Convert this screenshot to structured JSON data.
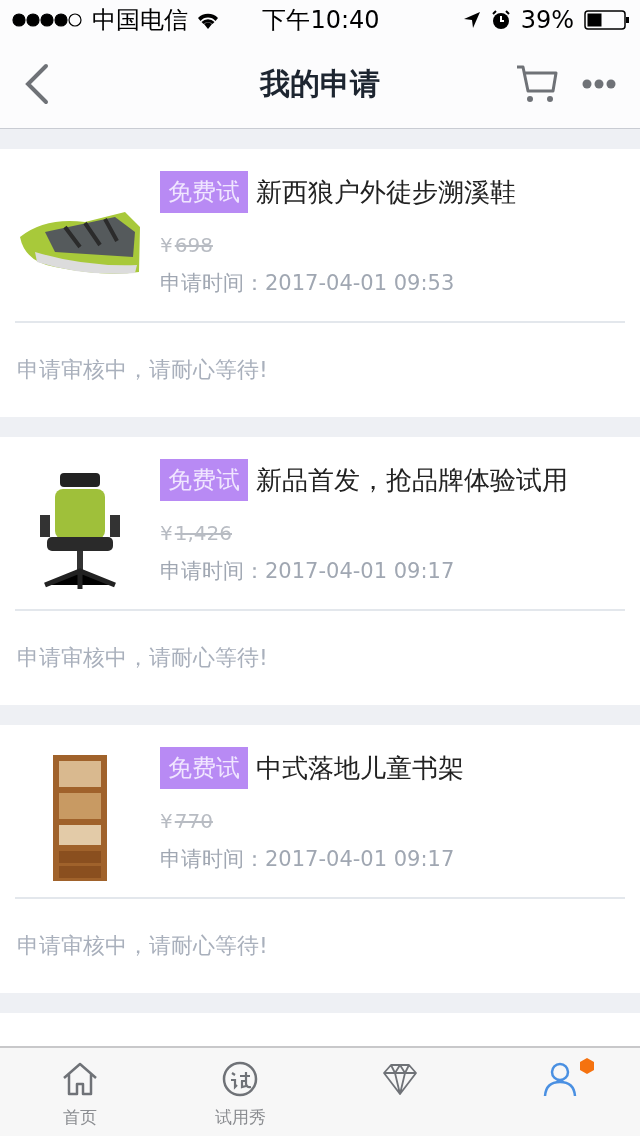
{
  "status_bar": {
    "carrier": "中国电信",
    "time": "下午10:40",
    "battery_text": "39%"
  },
  "nav": {
    "title": "我的申请"
  },
  "applications": [
    {
      "badge": "免费试",
      "title": "新西狼户外徒步溯溪鞋",
      "currency": "¥",
      "price": "698",
      "time": "申请时间：2017-04-01 09:53",
      "status": "申请审核中，请耐心等待!",
      "kind": "shoe"
    },
    {
      "badge": "免费试",
      "title": "新品首发，抢品牌体验试用",
      "currency": "¥",
      "price": "1,426",
      "time": "申请时间：2017-04-01 09:17",
      "status": "申请审核中，请耐心等待!",
      "kind": "chair"
    },
    {
      "badge": "免费试",
      "title": "中式落地儿童书架",
      "currency": "¥",
      "price": "770",
      "time": "申请时间：2017-04-01 09:17",
      "status": "申请审核中，请耐心等待!",
      "kind": "shelf"
    },
    {
      "kind": "partial"
    }
  ],
  "tab_bar": [
    {
      "label": "首页",
      "selected": false,
      "dot": false
    },
    {
      "label": "试用秀",
      "selected": false,
      "dot": false
    },
    {
      "selected": false,
      "dot": false
    },
    {
      "selected": true,
      "dot": true
    }
  ]
}
